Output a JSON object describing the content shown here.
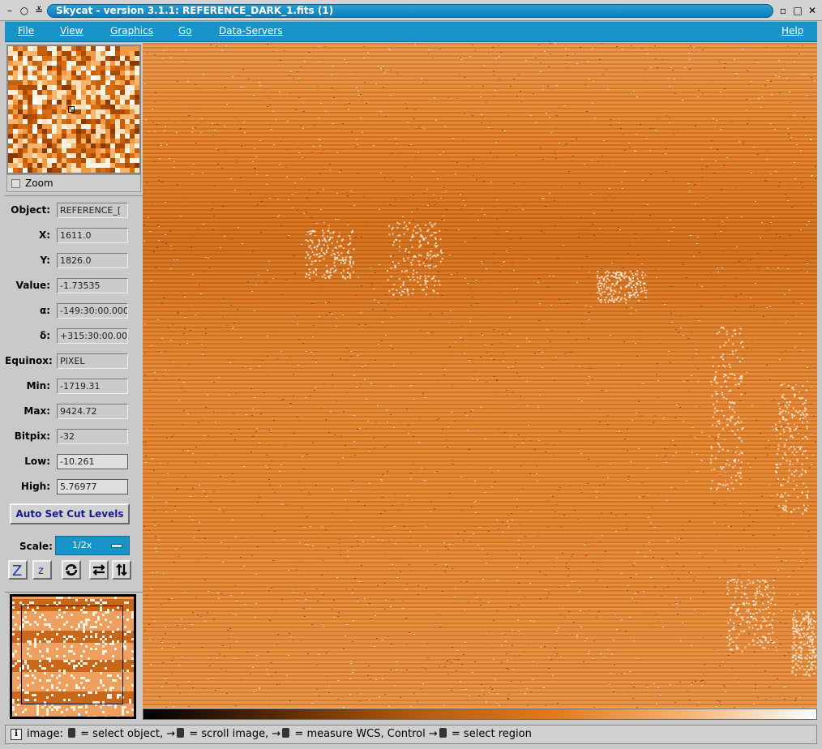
{
  "window": {
    "title": "Skycat - version 3.1.1: REFERENCE_DARK_1.fits (1)",
    "controls": {
      "menu": "–",
      "circle": "○",
      "shade": "≚",
      "iconify": "▫",
      "maximize": "□",
      "close": "✕"
    }
  },
  "menubar": {
    "items": [
      "File",
      "View",
      "Graphics",
      "Go",
      "Data-Servers"
    ],
    "help": "Help"
  },
  "magnifier": {
    "zoom_label": "Zoom"
  },
  "info": {
    "object_label": "Object:",
    "object_value": "REFERENCE_[",
    "x_label": "X:",
    "x_value": "1611.0",
    "y_label": "Y:",
    "y_value": "1826.0",
    "value_label": "Value:",
    "value_value": "-1.73535",
    "alpha_label": "α:",
    "alpha_value": "-149:30:00.000",
    "delta_label": "δ:",
    "delta_value": "+315:30:00.00",
    "equinox_label": "Equinox:",
    "equinox_value": "PIXEL",
    "min_label": "Min:",
    "min_value": "-1719.31",
    "max_label": "Max:",
    "max_value": "9424.72",
    "bitpix_label": "Bitpix:",
    "bitpix_value": "-32",
    "low_label": "Low:",
    "low_value": "-10.261",
    "high_label": "High:",
    "high_value": "5.76977"
  },
  "controls": {
    "autoset_label": "Auto Set Cut Levels",
    "scale_label": "Scale:",
    "scale_value": "1/2x",
    "tool_icons": [
      "zoom-in-icon",
      "zoom-out-icon",
      "rotate-icon",
      "flip-x-icon",
      "flip-y-icon"
    ]
  },
  "statusbar": {
    "icon": "i",
    "prefix": "image:",
    "part1": "= select object,",
    "part2": "= scroll image,",
    "part3": "= measure WCS, Control",
    "part4": "= select region"
  },
  "colors": {
    "accent": "#1793c8",
    "image_base": "#e0781c"
  }
}
